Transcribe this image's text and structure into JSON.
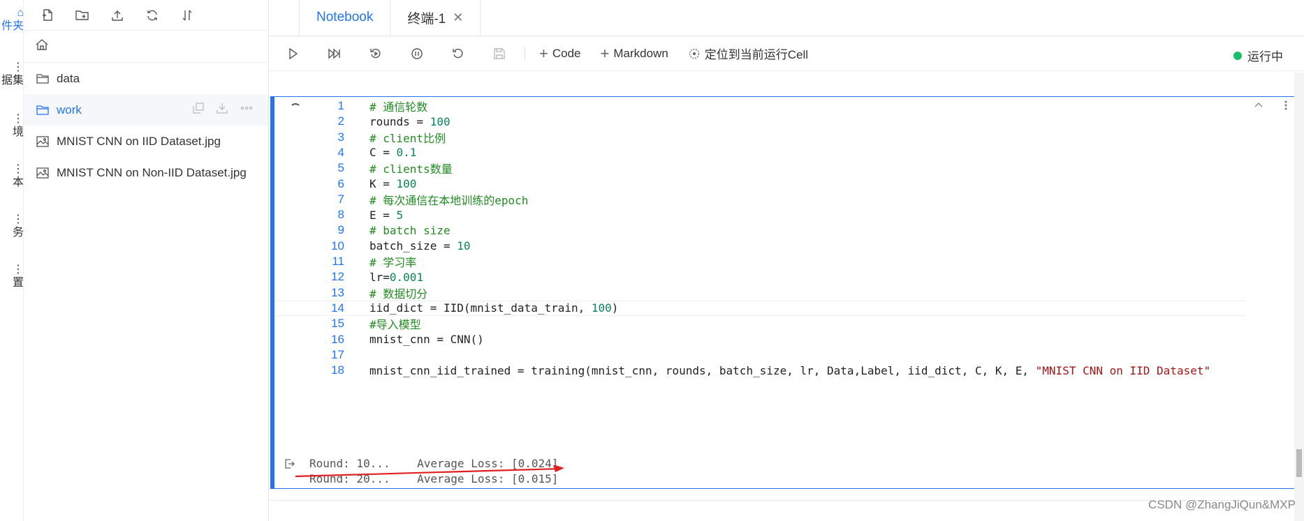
{
  "activity": [
    {
      "label": "件夹",
      "icon": "folder-icon"
    },
    {
      "label": "据集",
      "icon": "dataset-icon"
    },
    {
      "label": "境",
      "icon": "environment-icon"
    },
    {
      "label": "本",
      "icon": "version-icon"
    },
    {
      "label": "务",
      "icon": "task-icon"
    },
    {
      "label": "置",
      "icon": "settings-icon"
    }
  ],
  "files": [
    {
      "name": "data",
      "type": "folder"
    },
    {
      "name": "work",
      "type": "folder"
    },
    {
      "name": "MNIST CNN on IID Dataset.jpg",
      "type": "image"
    },
    {
      "name": "MNIST CNN on Non-IID Dataset.jpg",
      "type": "image"
    }
  ],
  "tabs": [
    {
      "label": "Notebook",
      "active": true
    },
    {
      "label": "终端-1",
      "active": false
    }
  ],
  "toolbar": {
    "code_label": "Code",
    "markdown_label": "Markdown",
    "locate_label": "定位到当前运行Cell",
    "status": "运行中"
  },
  "code_lines": [
    {
      "n": "1",
      "html": "<span class=\"cm\"># 通信轮数</span>"
    },
    {
      "n": "2",
      "html": "rounds = <span class=\"num\">100</span>"
    },
    {
      "n": "3",
      "html": "<span class=\"cm\"># client比例</span>"
    },
    {
      "n": "4",
      "html": "C = <span class=\"num\">0.1</span>"
    },
    {
      "n": "5",
      "html": "<span class=\"cm\"># clients数量</span>"
    },
    {
      "n": "6",
      "html": "K = <span class=\"num\">100</span>"
    },
    {
      "n": "7",
      "html": "<span class=\"cm\"># 每次通信在本地训练的epoch</span>"
    },
    {
      "n": "8",
      "html": "E = <span class=\"num\">5</span>"
    },
    {
      "n": "9",
      "html": "<span class=\"cm\"># batch size</span>"
    },
    {
      "n": "10",
      "html": "batch_size = <span class=\"num\">10</span>"
    },
    {
      "n": "11",
      "html": "<span class=\"cm\"># 学习率</span>"
    },
    {
      "n": "12",
      "html": "lr=<span class=\"num\">0.001</span>"
    },
    {
      "n": "13",
      "html": "<span class=\"cm\"># 数据切分</span>"
    },
    {
      "n": "14",
      "html": "iid_dict = IID(mnist_data_train, <span class=\"num\">100</span>)"
    },
    {
      "n": "15",
      "html": "<span class=\"cm\">#导入模型</span>"
    },
    {
      "n": "16",
      "html": "mnist_cnn = CNN()"
    },
    {
      "n": "17",
      "html": ""
    },
    {
      "n": "18",
      "html": "mnist_cnn_iid_trained = training(mnist_cnn, rounds, batch_size, lr, Data,Label, iid_dict, C, K, E, <span class=\"str\">\"MNIST CNN on IID Dataset\"</span>"
    }
  ],
  "output_lines": [
    "Round: 10...    Average Loss: [0.024]",
    "Round: 20...    Average Loss: [0.015]"
  ],
  "watermark": "CSDN @ZhangJiQun&MXP",
  "colors": {
    "accent": "#2474f0",
    "running": "#19be6b",
    "arrow": "#e02020"
  }
}
